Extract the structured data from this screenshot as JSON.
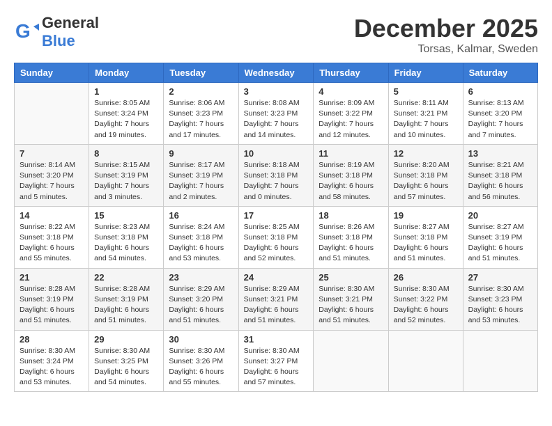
{
  "header": {
    "logo_text_general": "General",
    "logo_text_blue": "Blue",
    "month": "December 2025",
    "location": "Torsas, Kalmar, Sweden"
  },
  "weekdays": [
    "Sunday",
    "Monday",
    "Tuesday",
    "Wednesday",
    "Thursday",
    "Friday",
    "Saturday"
  ],
  "weeks": [
    [
      {
        "day": "",
        "info": ""
      },
      {
        "day": "1",
        "info": "Sunrise: 8:05 AM\nSunset: 3:24 PM\nDaylight: 7 hours\nand 19 minutes."
      },
      {
        "day": "2",
        "info": "Sunrise: 8:06 AM\nSunset: 3:23 PM\nDaylight: 7 hours\nand 17 minutes."
      },
      {
        "day": "3",
        "info": "Sunrise: 8:08 AM\nSunset: 3:23 PM\nDaylight: 7 hours\nand 14 minutes."
      },
      {
        "day": "4",
        "info": "Sunrise: 8:09 AM\nSunset: 3:22 PM\nDaylight: 7 hours\nand 12 minutes."
      },
      {
        "day": "5",
        "info": "Sunrise: 8:11 AM\nSunset: 3:21 PM\nDaylight: 7 hours\nand 10 minutes."
      },
      {
        "day": "6",
        "info": "Sunrise: 8:13 AM\nSunset: 3:20 PM\nDaylight: 7 hours\nand 7 minutes."
      }
    ],
    [
      {
        "day": "7",
        "info": "Sunrise: 8:14 AM\nSunset: 3:20 PM\nDaylight: 7 hours\nand 5 minutes."
      },
      {
        "day": "8",
        "info": "Sunrise: 8:15 AM\nSunset: 3:19 PM\nDaylight: 7 hours\nand 3 minutes."
      },
      {
        "day": "9",
        "info": "Sunrise: 8:17 AM\nSunset: 3:19 PM\nDaylight: 7 hours\nand 2 minutes."
      },
      {
        "day": "10",
        "info": "Sunrise: 8:18 AM\nSunset: 3:18 PM\nDaylight: 7 hours\nand 0 minutes."
      },
      {
        "day": "11",
        "info": "Sunrise: 8:19 AM\nSunset: 3:18 PM\nDaylight: 6 hours\nand 58 minutes."
      },
      {
        "day": "12",
        "info": "Sunrise: 8:20 AM\nSunset: 3:18 PM\nDaylight: 6 hours\nand 57 minutes."
      },
      {
        "day": "13",
        "info": "Sunrise: 8:21 AM\nSunset: 3:18 PM\nDaylight: 6 hours\nand 56 minutes."
      }
    ],
    [
      {
        "day": "14",
        "info": "Sunrise: 8:22 AM\nSunset: 3:18 PM\nDaylight: 6 hours\nand 55 minutes."
      },
      {
        "day": "15",
        "info": "Sunrise: 8:23 AM\nSunset: 3:18 PM\nDaylight: 6 hours\nand 54 minutes."
      },
      {
        "day": "16",
        "info": "Sunrise: 8:24 AM\nSunset: 3:18 PM\nDaylight: 6 hours\nand 53 minutes."
      },
      {
        "day": "17",
        "info": "Sunrise: 8:25 AM\nSunset: 3:18 PM\nDaylight: 6 hours\nand 52 minutes."
      },
      {
        "day": "18",
        "info": "Sunrise: 8:26 AM\nSunset: 3:18 PM\nDaylight: 6 hours\nand 51 minutes."
      },
      {
        "day": "19",
        "info": "Sunrise: 8:27 AM\nSunset: 3:18 PM\nDaylight: 6 hours\nand 51 minutes."
      },
      {
        "day": "20",
        "info": "Sunrise: 8:27 AM\nSunset: 3:19 PM\nDaylight: 6 hours\nand 51 minutes."
      }
    ],
    [
      {
        "day": "21",
        "info": "Sunrise: 8:28 AM\nSunset: 3:19 PM\nDaylight: 6 hours\nand 51 minutes."
      },
      {
        "day": "22",
        "info": "Sunrise: 8:28 AM\nSunset: 3:19 PM\nDaylight: 6 hours\nand 51 minutes."
      },
      {
        "day": "23",
        "info": "Sunrise: 8:29 AM\nSunset: 3:20 PM\nDaylight: 6 hours\nand 51 minutes."
      },
      {
        "day": "24",
        "info": "Sunrise: 8:29 AM\nSunset: 3:21 PM\nDaylight: 6 hours\nand 51 minutes."
      },
      {
        "day": "25",
        "info": "Sunrise: 8:30 AM\nSunset: 3:21 PM\nDaylight: 6 hours\nand 51 minutes."
      },
      {
        "day": "26",
        "info": "Sunrise: 8:30 AM\nSunset: 3:22 PM\nDaylight: 6 hours\nand 52 minutes."
      },
      {
        "day": "27",
        "info": "Sunrise: 8:30 AM\nSunset: 3:23 PM\nDaylight: 6 hours\nand 53 minutes."
      }
    ],
    [
      {
        "day": "28",
        "info": "Sunrise: 8:30 AM\nSunset: 3:24 PM\nDaylight: 6 hours\nand 53 minutes."
      },
      {
        "day": "29",
        "info": "Sunrise: 8:30 AM\nSunset: 3:25 PM\nDaylight: 6 hours\nand 54 minutes."
      },
      {
        "day": "30",
        "info": "Sunrise: 8:30 AM\nSunset: 3:26 PM\nDaylight: 6 hours\nand 55 minutes."
      },
      {
        "day": "31",
        "info": "Sunrise: 8:30 AM\nSunset: 3:27 PM\nDaylight: 6 hours\nand 57 minutes."
      },
      {
        "day": "",
        "info": ""
      },
      {
        "day": "",
        "info": ""
      },
      {
        "day": "",
        "info": ""
      }
    ]
  ]
}
